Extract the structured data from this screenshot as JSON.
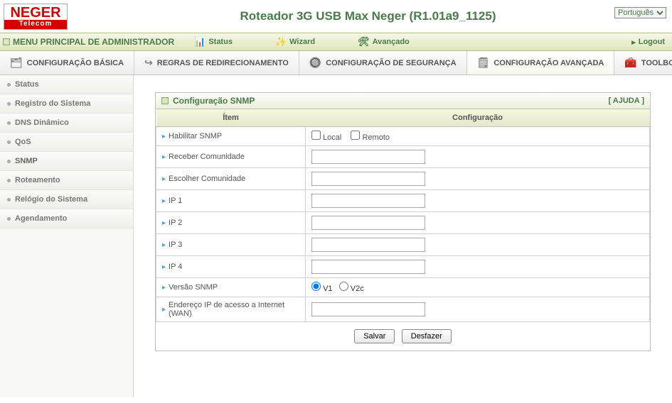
{
  "logo": {
    "top": "NEGER",
    "bottom": "Telecom"
  },
  "title": "Roteador 3G USB Max Neger   (R1.01a9_1125)",
  "language": "Português",
  "menubar": {
    "main": "MENU PRINCIPAL DE ADMINISTRADOR",
    "status": "Status",
    "wizard": "Wizard",
    "advanced": "Avançado",
    "logout": "Logout"
  },
  "tabs": {
    "basic": "CONFIGURAÇÃO BÁSICA",
    "redirect": "REGRAS DE REDIRECIONAMENTO",
    "security": "CONFIGURAÇÃO DE SEGURANÇA",
    "advanced": "CONFIGURAÇÃO AVANÇADA",
    "toolbox": "TOOLBOX"
  },
  "sidebar": {
    "items": [
      {
        "label": "Status"
      },
      {
        "label": "Registro do Sistema"
      },
      {
        "label": "DNS Dinâmico"
      },
      {
        "label": "QoS"
      },
      {
        "label": "SNMP"
      },
      {
        "label": "Roteamento"
      },
      {
        "label": "Relógio do Sistema"
      },
      {
        "label": "Agendamento"
      }
    ]
  },
  "panel": {
    "title": "Configuração SNMP",
    "help": "[ AJUDA ]",
    "col_item": "Ítem",
    "col_cfg": "Configuração",
    "rows": {
      "enable": "Habilitar SNMP",
      "local": "Local",
      "remote": "Remoto",
      "recv_comm": "Receber Comunidade",
      "choose_comm": "Escolher Comunidade",
      "ip1": "IP 1",
      "ip2": "IP 2",
      "ip3": "IP 3",
      "ip4": "IP 4",
      "version": "Versão SNMP",
      "v1": "V1",
      "v2c": "V2c",
      "wan_ip": "Endereço IP de acesso a Internet (WAN)"
    },
    "buttons": {
      "save": "Salvar",
      "undo": "Desfazer"
    }
  }
}
